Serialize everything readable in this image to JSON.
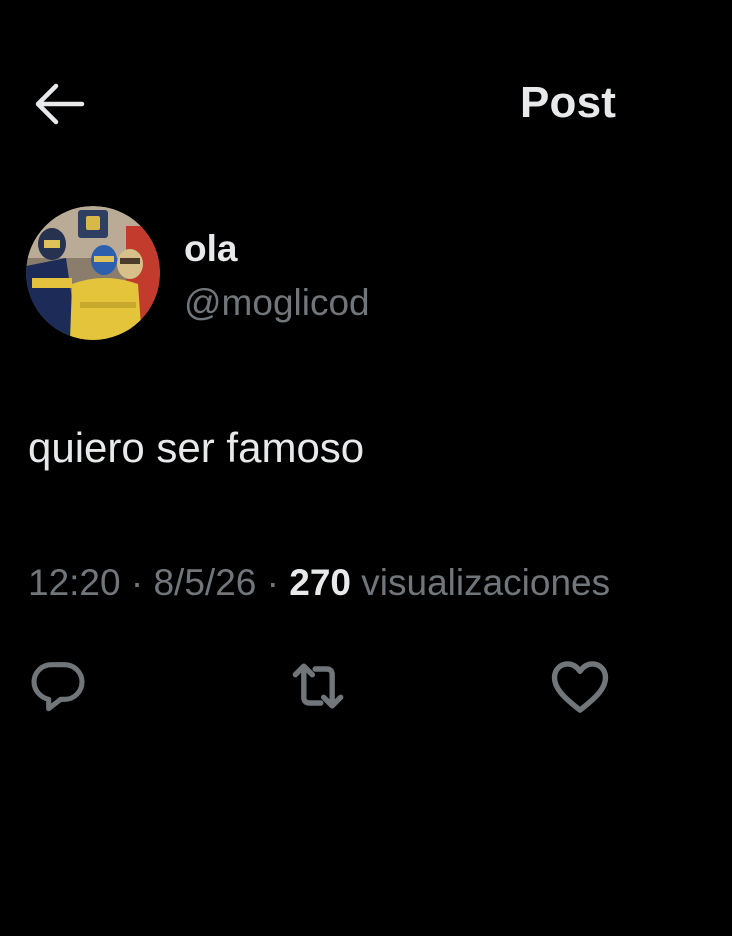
{
  "header": {
    "back_icon": "arrow-left-icon",
    "title": "Post"
  },
  "author": {
    "display_name": "ola",
    "handle": "@moglicod",
    "avatar_icon": "profile-avatar"
  },
  "post": {
    "text": "quiero ser famoso",
    "time": "12:20",
    "separator": "·",
    "date": "8/5/26",
    "views_count": "270",
    "views_label": "visualizaciones"
  },
  "actions": {
    "reply_icon": "reply-icon",
    "repost_icon": "repost-icon",
    "like_icon": "heart-icon"
  },
  "colors": {
    "background": "#000000",
    "primary_text": "#e7e9ea",
    "secondary_text": "#71767b",
    "icon": "#71767b"
  }
}
